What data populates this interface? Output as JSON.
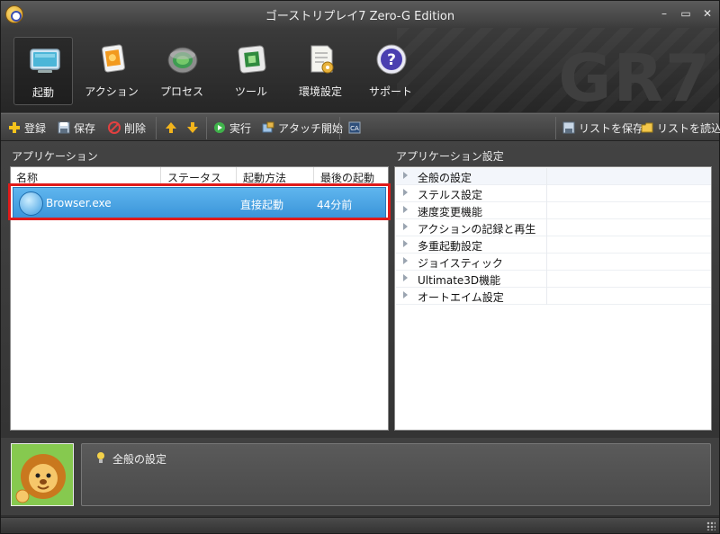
{
  "window": {
    "title": "ゴーストリプレイ7 Zero-G Edition",
    "minimize": "–",
    "maximize": "▭",
    "close": "✕",
    "brand_watermark": "GR7"
  },
  "main_toolbar": [
    {
      "label": "起動",
      "icon": "monitor-icon",
      "active": true
    },
    {
      "label": "アクション",
      "icon": "action-card-icon",
      "active": false
    },
    {
      "label": "プロセス",
      "icon": "process-disk-icon",
      "active": false
    },
    {
      "label": "ツール",
      "icon": "tool-chip-icon",
      "active": false
    },
    {
      "label": "環境設定",
      "icon": "settings-document-icon",
      "active": false
    },
    {
      "label": "サポート",
      "icon": "help-icon",
      "active": false
    }
  ],
  "sub_toolbar": {
    "register": "登録",
    "save": "保存",
    "delete": "削除",
    "run": "実行",
    "attach": "アタッチ開始",
    "save_list": "リストを保存",
    "load_list": "リストを読込"
  },
  "applications": {
    "panel_title": "アプリケーション",
    "columns": [
      "名称",
      "ステータス",
      "起動方法",
      "最後の起動"
    ],
    "rows": [
      {
        "name": "Browser.exe",
        "status": "",
        "launch_method": "直接起動",
        "last_launch": "44分前",
        "selected": true
      }
    ]
  },
  "app_settings": {
    "panel_title": "アプリケーション設定",
    "items": [
      "全般の設定",
      "ステルス設定",
      "速度変更機能",
      "アクションの記録と再生",
      "多重起動設定",
      "ジョイスティック",
      "Ultimate3D機能",
      "オートエイム設定"
    ]
  },
  "description": {
    "text": "全般の設定",
    "icon": "lightbulb-icon"
  },
  "colors": {
    "selection_blue": "#3a93d9",
    "highlight_red": "#e01a1a",
    "dark_chrome": "#3a3a3a"
  }
}
